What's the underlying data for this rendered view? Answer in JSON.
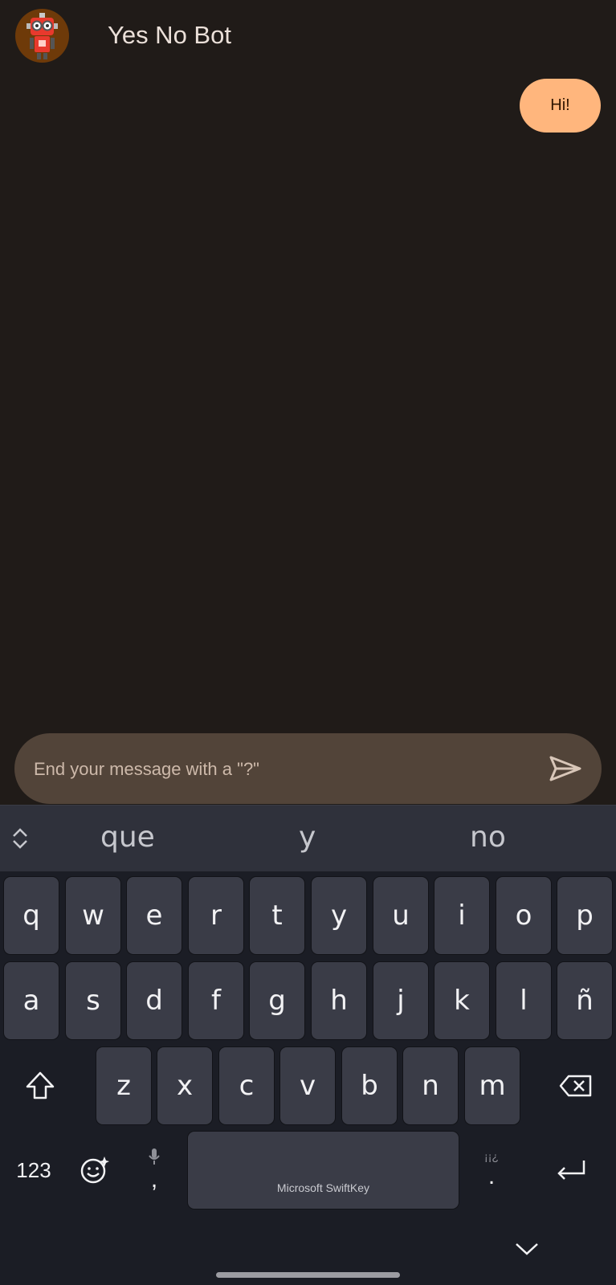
{
  "app": {
    "title": "Yes No Bot",
    "avatar_icon": "robot-icon"
  },
  "messages": [
    {
      "sender": "user",
      "text": "Hi!"
    }
  ],
  "composer": {
    "placeholder": "End your message with a \"?\"",
    "value": "",
    "send_icon": "send-icon"
  },
  "keyboard": {
    "suggestions": [
      "que",
      "y",
      "no"
    ],
    "row1": [
      "q",
      "w",
      "e",
      "r",
      "t",
      "y",
      "u",
      "i",
      "o",
      "p"
    ],
    "row2": [
      "a",
      "s",
      "d",
      "f",
      "g",
      "h",
      "j",
      "k",
      "l",
      "ñ"
    ],
    "row3": [
      "z",
      "x",
      "c",
      "v",
      "b",
      "n",
      "m"
    ],
    "numbers_label": "123",
    "comma_label": ",",
    "period_label": ".",
    "punct_hint": "¡¡¿",
    "space_label": "Microsoft SwiftKey"
  },
  "colors": {
    "background": "#201b18",
    "user_bubble": "#ffb67d",
    "composer_bg": "#524439",
    "keyboard_bg": "#1b1d25",
    "key_bg": "#3a3c47"
  }
}
